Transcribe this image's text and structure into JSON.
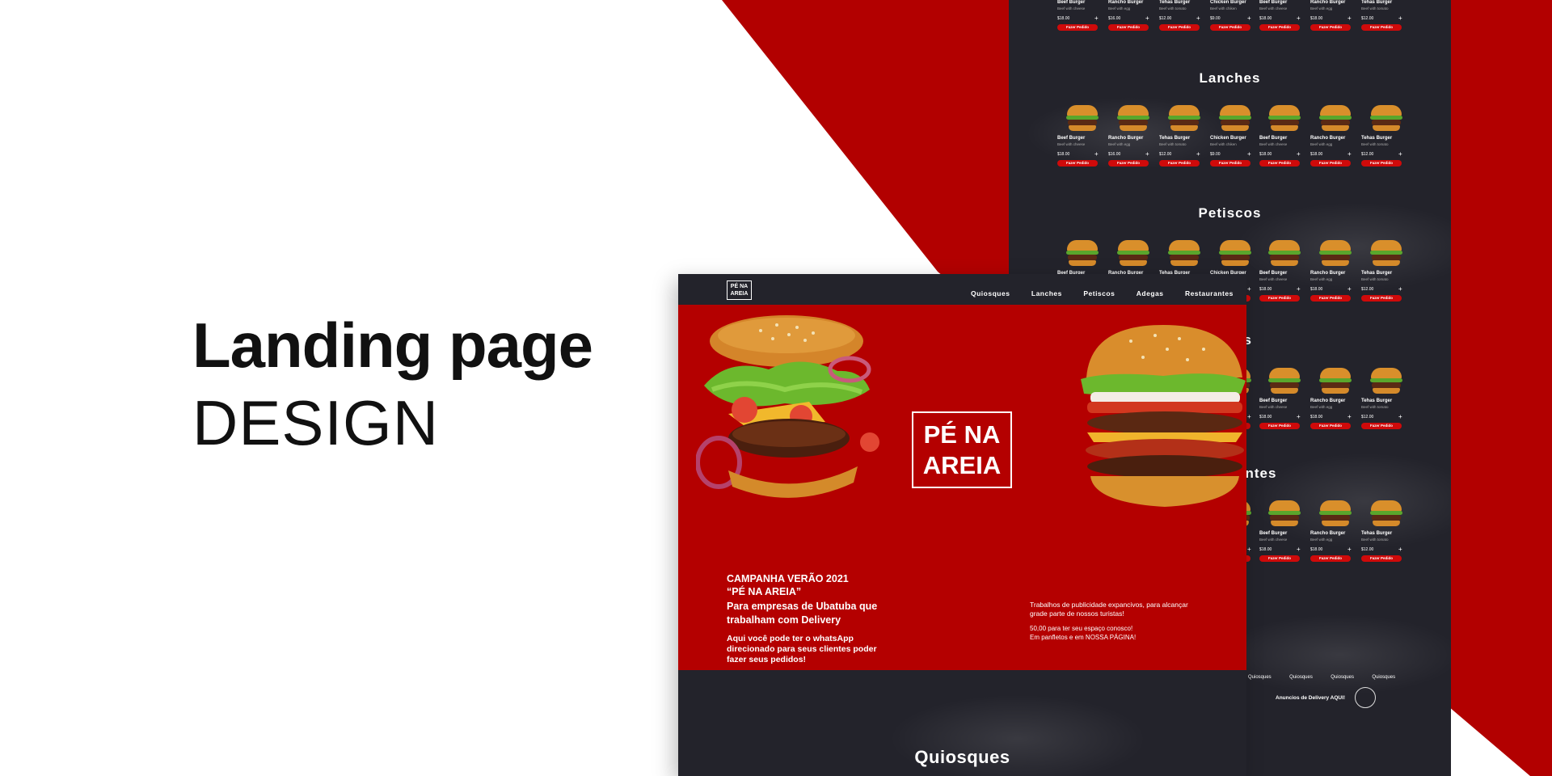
{
  "presentation": {
    "title_line1": "Landing page",
    "title_line2": "DESIGN"
  },
  "colors": {
    "accent_red": "#b20000",
    "dark_bg": "#23232b",
    "button_red": "#cf0a0a"
  },
  "nav": {
    "logo_line1": "PÉ NA",
    "logo_line2": "AREIA",
    "links": [
      "Quiosques",
      "Lanches",
      "Petiscos",
      "Adegas",
      "Restaurantes"
    ]
  },
  "hero": {
    "brand_line1": "PÉ NA",
    "brand_line2": "AREIA",
    "campaign_title": "CAMPANHA VERÃO 2021",
    "campaign_quote": "“PÉ NA AREIA”",
    "campaign_line1": "Para empresas de Ubatuba que",
    "campaign_line2": "trabalham com Delivery",
    "whatsapp_line1": "Aqui você pode ter o whatsApp",
    "whatsapp_line2": "direcionado para seus clientes poder",
    "whatsapp_line3": "fazer seus pedidos!",
    "right_line1": "Trabalhos de publicidade expancivos, para alcançar",
    "right_line2": "grade parte de nossos turistas!",
    "right_line3": "50,00 para ter seu espaço conosco!",
    "right_line4": "Em panfletos e em NOSSA PÁGINA!"
  },
  "front_section_title": "Quiosques",
  "menu": {
    "sections": [
      "Lanches",
      "Petiscos",
      "as",
      "antes"
    ],
    "items": [
      {
        "name": "Beef Burger",
        "desc": "Beef with cheese",
        "price": "$18.00"
      },
      {
        "name": "Rancho Burger",
        "desc": "Beef with egg",
        "price": "$16.00"
      },
      {
        "name": "Tehas Burger",
        "desc": "Beef with tomato",
        "price": "$12.00"
      },
      {
        "name": "Chicken Burger",
        "desc": "Beef with chiken",
        "price": "$9.00"
      },
      {
        "name": "Beef Burger",
        "desc": "Beef with cheese",
        "price": "$18.00"
      },
      {
        "name": "Rancho Burger",
        "desc": "Beef with egg",
        "price": "$18.00"
      },
      {
        "name": "Tehas Burger",
        "desc": "Beef with tomato",
        "price": "$12.00"
      }
    ],
    "button_label": "Fazer Pedido",
    "plus": "+"
  },
  "footer": {
    "links": [
      "Quiosques",
      "Quiosques",
      "Quiosques",
      "Quiosques"
    ],
    "delivery_label": "Anuncios de Delivery AQUI!"
  }
}
